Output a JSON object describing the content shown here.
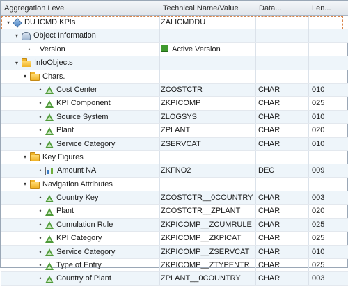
{
  "columns": {
    "aggregation_level": "Aggregation Level",
    "technical_name": "Technical Name/Value",
    "data_type": "Data...",
    "length": "Len..."
  },
  "rows": [
    {
      "label": "DU ICMD KPIs",
      "value": "ZALICMDDU",
      "type": "",
      "len": "",
      "icon": "infocube-icon",
      "expander": "down"
    },
    {
      "label": "Object Information",
      "value": "",
      "type": "",
      "len": "",
      "icon": "object-information-icon",
      "expander": "down"
    },
    {
      "label": "Version",
      "value": "Active Version",
      "type": "",
      "len": "",
      "icon": "",
      "expander": "dot"
    },
    {
      "label": "InfoObjects",
      "value": "",
      "type": "",
      "len": "",
      "icon": "folder-icon",
      "expander": "down"
    },
    {
      "label": "Chars.",
      "value": "",
      "type": "",
      "len": "",
      "icon": "folder-icon",
      "expander": "down"
    },
    {
      "label": "Cost Center",
      "value": "ZCOSTCTR",
      "type": "CHAR",
      "len": "010",
      "icon": "characteristic-icon",
      "expander": "dot"
    },
    {
      "label": "KPI Component",
      "value": "ZKPICOMP",
      "type": "CHAR",
      "len": "025",
      "icon": "characteristic-icon",
      "expander": "dot"
    },
    {
      "label": "Source System",
      "value": "ZLOGSYS",
      "type": "CHAR",
      "len": "010",
      "icon": "characteristic-icon",
      "expander": "dot"
    },
    {
      "label": "Plant",
      "value": "ZPLANT",
      "type": "CHAR",
      "len": "020",
      "icon": "characteristic-icon",
      "expander": "dot"
    },
    {
      "label": "Service Category",
      "value": "ZSERVCAT",
      "type": "CHAR",
      "len": "010",
      "icon": "characteristic-icon",
      "expander": "dot"
    },
    {
      "label": "Key Figures",
      "value": "",
      "type": "",
      "len": "",
      "icon": "folder-icon",
      "expander": "down"
    },
    {
      "label": "Amount NA",
      "value": "ZKFNO2",
      "type": "DEC",
      "len": "009",
      "icon": "key-figure-icon",
      "expander": "dot"
    },
    {
      "label": "Navigation Attributes",
      "value": "",
      "type": "",
      "len": "",
      "icon": "folder-icon",
      "expander": "down"
    },
    {
      "label": "Country Key",
      "value": "ZCOSTCTR__0COUNTRY",
      "type": "CHAR",
      "len": "003",
      "icon": "characteristic-icon",
      "expander": "dot"
    },
    {
      "label": "Plant",
      "value": "ZCOSTCTR__ZPLANT",
      "type": "CHAR",
      "len": "020",
      "icon": "characteristic-icon",
      "expander": "dot"
    },
    {
      "label": "Cumulation Rule",
      "value": "ZKPICOMP__ZCUMRULE",
      "type": "CHAR",
      "len": "025",
      "icon": "characteristic-icon",
      "expander": "dot"
    },
    {
      "label": "KPI Category",
      "value": "ZKPICOMP__ZKPICAT",
      "type": "CHAR",
      "len": "025",
      "icon": "characteristic-icon",
      "expander": "dot"
    },
    {
      "label": "Service Category",
      "value": "ZKPICOMP__ZSERVCAT",
      "type": "CHAR",
      "len": "010",
      "icon": "characteristic-icon",
      "expander": "dot"
    },
    {
      "label": "Type of Entry",
      "value": "ZKPICOMP__ZTYPENTR",
      "type": "CHAR",
      "len": "025",
      "icon": "characteristic-icon",
      "expander": "dot"
    },
    {
      "label": "Country of Plant",
      "value": "ZPLANT__0COUNTRY",
      "type": "CHAR",
      "len": "003",
      "icon": "characteristic-icon",
      "expander": "dot"
    }
  ],
  "colors": {
    "selection_border": "#d9844a",
    "alt_row": "#eef5fa",
    "active_version": "#3f9a2e"
  }
}
